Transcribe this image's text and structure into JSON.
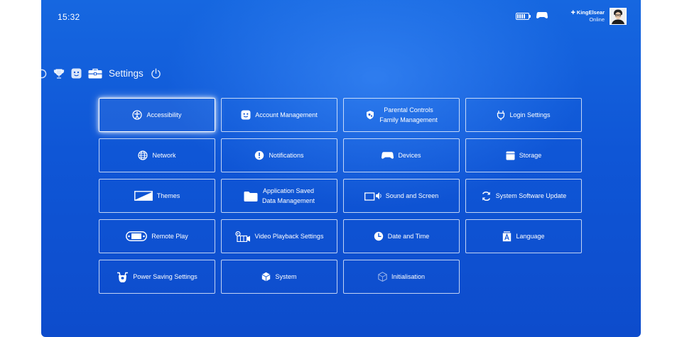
{
  "statusbar": {
    "time": "15:32",
    "user": {
      "name": "✚ KingElsear",
      "status": "Online"
    }
  },
  "function_bar": {
    "title": "Settings"
  },
  "tiles": [
    {
      "id": "accessibility",
      "lines": [
        "Accessibility"
      ],
      "icon": "accessibility-icon",
      "focused": true
    },
    {
      "id": "account-management",
      "lines": [
        "Account Management"
      ],
      "icon": "smiley-face-icon"
    },
    {
      "id": "parental-controls",
      "lines": [
        "Parental Controls",
        "Family Management"
      ],
      "icon": "parental-controls-icon"
    },
    {
      "id": "login-settings",
      "lines": [
        "Login Settings"
      ],
      "icon": "power-plug-icon"
    },
    {
      "id": "network",
      "lines": [
        "Network"
      ],
      "icon": "globe-icon"
    },
    {
      "id": "notifications",
      "lines": [
        "Notifications"
      ],
      "icon": "notification-icon"
    },
    {
      "id": "devices",
      "lines": [
        "Devices"
      ],
      "icon": "controller-icon"
    },
    {
      "id": "storage",
      "lines": [
        "Storage"
      ],
      "icon": "storage-icon"
    },
    {
      "id": "themes",
      "lines": [
        "Themes"
      ],
      "icon": "theme-icon"
    },
    {
      "id": "application-saved-data",
      "lines": [
        "Application Saved",
        "Data Management"
      ],
      "icon": "folder-icon"
    },
    {
      "id": "sound-and-screen",
      "lines": [
        "Sound and Screen"
      ],
      "icon": "screen-sound-icon"
    },
    {
      "id": "system-software-update",
      "lines": [
        "System Software Update"
      ],
      "icon": "update-arrows-icon"
    },
    {
      "id": "remote-play",
      "lines": [
        "Remote Play"
      ],
      "icon": "remote-play-icon"
    },
    {
      "id": "video-playback-settings",
      "lines": [
        "Video Playback Settings"
      ],
      "icon": "video-icon"
    },
    {
      "id": "date-and-time",
      "lines": [
        "Date and Time"
      ],
      "icon": "clock-icon"
    },
    {
      "id": "language",
      "lines": [
        "Language"
      ],
      "icon": "language-icon"
    },
    {
      "id": "power-saving-settings",
      "lines": [
        "Power Saving Settings"
      ],
      "icon": "power-saving-icon"
    },
    {
      "id": "system",
      "lines": [
        "System"
      ],
      "icon": "cube-icon"
    },
    {
      "id": "initialisation",
      "lines": [
        "Initialisation"
      ],
      "icon": "cube-outline-icon",
      "dim": true
    }
  ],
  "colors": {
    "background": "#0f56d6",
    "text": "#ffffff"
  }
}
